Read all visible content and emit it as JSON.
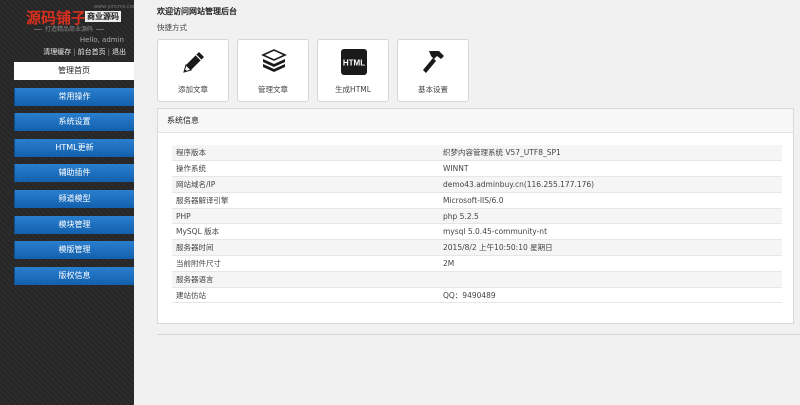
{
  "logo": {
    "name": "源码铺子",
    "badge": "商业源码",
    "url": "www.ymcms.com",
    "slogan": "打造精品商业源码"
  },
  "user": {
    "greeting": "Hello, admin"
  },
  "top_links": [
    "清理缓存",
    "前台首页",
    "退出"
  ],
  "menu": [
    {
      "label": "管理首页",
      "active": true
    },
    {
      "label": "常用操作"
    },
    {
      "label": "系统设置"
    },
    {
      "label": "HTML更新"
    },
    {
      "label": "辅助插件"
    },
    {
      "label": "频道模型"
    },
    {
      "label": "模块管理"
    },
    {
      "label": "模版管理"
    },
    {
      "label": "版权信息"
    }
  ],
  "welcome": "欢迎访问网站管理后台",
  "shortcut_title": "快捷方式",
  "shortcuts": [
    {
      "label": "添加文章",
      "icon": "pencil-icon"
    },
    {
      "label": "管理文章",
      "icon": "stack-icon"
    },
    {
      "label": "生成HTML",
      "icon": "html-icon",
      "icon_text": "HTML"
    },
    {
      "label": "基本设置",
      "icon": "hammer-icon"
    }
  ],
  "sysinfo": {
    "title": "系统信息",
    "rows": [
      {
        "key": "程序版本",
        "value": "织梦内容管理系统 V57_UTF8_SP1"
      },
      {
        "key": "操作系统",
        "value": "WINNT"
      },
      {
        "key": "网站域名/IP",
        "value": "demo43.adminbuy.cn(116.255.177.176)"
      },
      {
        "key": "服务器解译引擎",
        "value": "Microsoft-IIS/6.0"
      },
      {
        "key": "PHP",
        "value": "php 5.2.5"
      },
      {
        "key": "MySQL 版本",
        "value": "mysql 5.0.45-community-nt"
      },
      {
        "key": "服务器时间",
        "value": "2015/8/2 上午10:50:10 星期日"
      },
      {
        "key": "当前附件尺寸",
        "value": "2M"
      },
      {
        "key": "服务器语言",
        "value": ""
      },
      {
        "key": "建站仿站",
        "value": "QQ：9490489"
      }
    ]
  },
  "colors": {
    "menu_blue": "#1a6fc0",
    "logo_red": "#d8301f",
    "sidebar_bg": "#292929"
  }
}
